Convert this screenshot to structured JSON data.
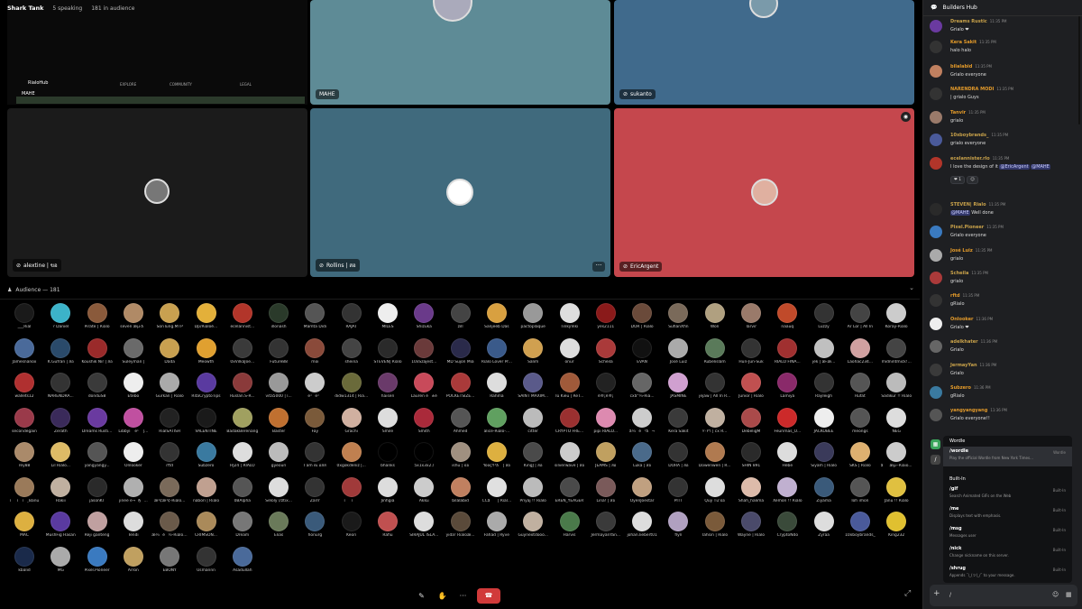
{
  "topbar": {
    "title": "Shark Tank",
    "speaking": "5 speaking",
    "audience": "181 in audience"
  },
  "tiles": [
    {
      "label": "MAHE",
      "color": "#5e8b96"
    },
    {
      "label": "sukanto",
      "color": "#406a8c"
    },
    {
      "label": "alextine | ขอ",
      "color": "#1b1b1b"
    },
    {
      "label": "Rollins | สอ",
      "color": "#406a7d"
    },
    {
      "label": "EricArgent",
      "color": "#c5474d"
    }
  ],
  "screen_share": {
    "brand": "RialoHub",
    "nav": [
      "EXPLORE",
      "COMMUNITY",
      "LEGAL"
    ],
    "name": "MAHE"
  },
  "audience_header": "Audience — 181",
  "audience": [
    {
      "n": "___Rial",
      "c": "#1a1a1a"
    },
    {
      "n": "? Daniel",
      "c": "#3cb3c9"
    },
    {
      "n": "Pirate | Rialo",
      "c": "#8a5a3b"
    },
    {
      "n": "seven æµ·å­",
      "c": "#b08a66"
    },
    {
      "n": "SonTung.MTP",
      "c": "#c8a050"
    },
    {
      "n": "Dp/Rialoè...",
      "c": "#e3b03a"
    },
    {
      "n": "ecelannist...",
      "c": "#b2352a"
    },
    {
      "n": "illonash",
      "c": "#2a3a2a"
    },
    {
      "n": "Mamta Didi",
      "c": "#555"
    },
    {
      "n": "RAJAT",
      "c": "#333"
    },
    {
      "n": "MILES",
      "c": "#eee"
    },
    {
      "n": "Shizuka",
      "c": "#6a3a8a"
    },
    {
      "n": "zill",
      "c": "#444"
    },
    {
      "n": "Sanjeeb Das",
      "c": "#d8a040"
    },
    {
      "n": "pactoplaque",
      "c": "#999"
    },
    {
      "n": "TinkyViki",
      "c": "#ddd"
    },
    {
      "n": "yes2111",
      "c": "#8a1a1a"
    },
    {
      "n": "DOR | Rialo",
      "c": "#6a4a3a"
    },
    {
      "n": "SufianXfin",
      "c": "#7a6a5a"
    },
    {
      "n": "Won",
      "c": "#b0a080"
    },
    {
      "n": "Tarvir",
      "c": "#9a7a6a"
    },
    {
      "n": "naauq",
      "c": "#c04a2a"
    },
    {
      "n": "Luzzy",
      "c": "#333"
    },
    {
      "n": "Ar Lor | All In",
      "c": "#444"
    },
    {
      "n": "Koray-Rialo",
      "c": "#ccc"
    },
    {
      "n": "Jamesnanox",
      "c": "#4a6a9a"
    },
    {
      "n": "K.Gufran | สอ",
      "c": "#2a4a6a"
    },
    {
      "n": "Koushik Nir | สอ",
      "c": "#9a2a2a"
    },
    {
      "n": "Süleyman |",
      "c": "#6a6a6a"
    },
    {
      "n": "Dada",
      "c": "#c8a050"
    },
    {
      "n": "Meowth",
      "c": "#e0a030"
    },
    {
      "n": "0xVilkaJoe...",
      "c": "#3a3a3a"
    },
    {
      "n": "Future88",
      "c": "#333"
    },
    {
      "n": "moi",
      "c": "#8a4a3a"
    },
    {
      "n": "sheina",
      "c": "#444"
    },
    {
      "n": "STEVEN| Rialo",
      "c": "#2a2a2a"
    },
    {
      "n": "10xSzajest...",
      "c": "#6a3a3a"
    },
    {
      "n": "MD Sujon Mia",
      "c": "#2a2a4a"
    },
    {
      "n": "Rialo Lover Pr...",
      "c": "#3a5a8a"
    },
    {
      "n": "Salim",
      "c": "#d0a050"
    },
    {
      "n": "onur",
      "c": "#ddd"
    },
    {
      "n": "Scheila",
      "c": "#aa3a3a"
    },
    {
      "n": "EVAN",
      "c": "#111"
    },
    {
      "n": "José Luiz",
      "c": "#aaa"
    },
    {
      "n": "Rubelislam",
      "c": "#5a7a5a"
    },
    {
      "n": "Hun-Jun-Suk",
      "c": "#333"
    },
    {
      "n": "RIALO FINA...",
      "c": "#a03030"
    },
    {
      "n": "jek | æ‹æ...",
      "c": "#c0c0c0"
    },
    {
      "n": "Laohac234...",
      "c": "#d0a0a0"
    },
    {
      "n": "midnintmick!...",
      "c": "#444"
    },
    {
      "n": "wallets12",
      "c": "#b03030"
    },
    {
      "n": "NARENDRA...",
      "c": "#333"
    },
    {
      "n": "donduS8",
      "c": "#3a3a3a"
    },
    {
      "n": "Etebo",
      "c": "#eee"
    },
    {
      "n": "Gürkan | Rialo",
      "c": "#aaa"
    },
    {
      "n": "RitaCryptoTips",
      "c": "#5a3aa0"
    },
    {
      "n": "Ruslan.S-R...",
      "c": "#8a3a3a"
    },
    {
      "n": "vita5000 | ì...",
      "c": "#999"
    },
    {
      "n": "ë¹ë¹",
      "c": "#ccc"
    },
    {
      "n": "didw1314 | Ria...",
      "c": "#6a6a3a"
    },
    {
      "n": "haisen",
      "c": "#6a3a6a"
    },
    {
      "n": "Lauren è±é",
      "c": "#c84a5a"
    },
    {
      "n": "POCKETSIZE...",
      "c": "#aa3a3a"
    },
    {
      "n": "Rahma",
      "c": "#ddd"
    },
    {
      "n": "SAINT MAXIM...",
      "c": "#5a5a8a"
    },
    {
      "n": "Tú Kiều | ReT...",
      "c": "#a05a3a"
    },
    {
      "n": "ê®¡ê®¡",
      "c": "#222"
    },
    {
      "n": "cxå°¼-Ria...",
      "c": "#666"
    },
    {
      "n": "JASMINE",
      "c": "#d0a0d0"
    },
    {
      "n": "jejaw | All In R...",
      "c": "#333"
    },
    {
      "n": "Junior | Rialo",
      "c": "#c05050"
    },
    {
      "n": "Lamiya",
      "c": "#8a2a6a"
    },
    {
      "n": "Rayleigh",
      "c": "#333"
    },
    {
      "n": "Rufat",
      "c": "#555"
    },
    {
      "n": "Sadikur !! Rialo",
      "c": "#bbb"
    },
    {
      "n": "secondegain",
      "c": "#9a3a4a"
    },
    {
      "n": "Zerath",
      "c": "#3a2a5a"
    },
    {
      "n": "Dreams Rusti...",
      "c": "#6a3aa0"
    },
    {
      "n": "Libbyì´ë¹ |...",
      "c": "#c050a0"
    },
    {
      "n": "RialSATISH",
      "c": "#222"
    },
    {
      "n": "VALENTINE",
      "c": "#1a1a1a"
    },
    {
      "n": "BadakBerenang",
      "c": "#a0a060"
    },
    {
      "n": "Baster",
      "c": "#c07030"
    },
    {
      "n": "Fay",
      "c": "#7a5a3a"
    },
    {
      "n": "Grachi",
      "c": "#d0b0a0"
    },
    {
      "n": "Smile",
      "c": "#ddd"
    },
    {
      "n": "Smith",
      "c": "#aa2a3a"
    },
    {
      "n": "Ahmed",
      "c": "#555"
    },
    {
      "n": "alice-Rialo-...",
      "c": "#60a060"
    },
    {
      "n": "citter",
      "c": "#bbb"
    },
    {
      "n": "CRYPTO FRE...",
      "c": "#9a3030"
    },
    {
      "n": "pipi RIALO...",
      "c": "#dd8ab0"
    },
    {
      "n": "å¼é³å¬",
      "c": "#ccc"
    },
    {
      "n": "Kera Sakit",
      "c": "#3a3a3a"
    },
    {
      "n": "٢٠٢٦ | cx R...",
      "c": "#c0b0a0"
    },
    {
      "n": "DebeligM",
      "c": "#aa4a4a"
    },
    {
      "n": "Feurimas_O...",
      "c": "#cc2a2a"
    },
    {
      "n": "JACKOBEE",
      "c": "#eee"
    },
    {
      "n": "meongs",
      "c": "#555"
    },
    {
      "n": "NEG",
      "c": "#ddd"
    },
    {
      "n": "rey88",
      "c": "#aa8a6a"
    },
    {
      "n": "Lil Rialo...",
      "c": "#ddbb66"
    },
    {
      "n": "yangyangy...",
      "c": "#555"
    },
    {
      "n": "Onlooker",
      "c": "#eee"
    },
    {
      "n": "rftd",
      "c": "#333"
    },
    {
      "n": "Subzero",
      "c": "#3a7aa0"
    },
    {
      "n": "HJ24 | RIALO",
      "c": "#ddd"
    },
    {
      "n": "gyeouri",
      "c": "#bbb"
    },
    {
      "n": "I am ตเ อสส",
      "c": "#333"
    },
    {
      "n": "0xgokdeniz |...",
      "c": "#c08050"
    },
    {
      "n": "bhanks",
      "c": "#000"
    },
    {
      "n": "5x1x3x2./",
      "c": "#000"
    },
    {
      "n": "ishu | ปอ",
      "c": "#a09080"
    },
    {
      "n": "YooçŸ³å­ | สอ",
      "c": "#ddb040"
    },
    {
      "n": "KingJ | สอ",
      "c": "#4a4a4a"
    },
    {
      "n": "silverwave | สอ",
      "c": "#ccc"
    },
    {
      "n": "JEAMS | สอ",
      "c": "#c0a060"
    },
    {
      "n": "Luka | สอ",
      "c": "#4a6a8a"
    },
    {
      "n": "DORA | สอ",
      "c": "#333"
    },
    {
      "n": "Dowenwen | R...",
      "c": "#b07a50"
    },
    {
      "n": "SHIN 891",
      "c": "#2a2a2a"
    },
    {
      "n": "Hebe",
      "c": "#ddd"
    },
    {
      "n": "Siyam | Rialo",
      "c": "#3a3a5a"
    },
    {
      "n": "SKS | Rialo",
      "c": "#ddb070"
    },
    {
      "n": "åæµ·-Riaio...",
      "c": "#ccc"
    },
    {
      "n": "ìì ì¸Banu",
      "c": "#9a7a5a"
    },
    {
      "n": "Hakii",
      "c": "#c0b0a0"
    },
    {
      "n": "jasonKT",
      "c": "#2a2a2a"
    },
    {
      "n": "jinee ë¬´ì§...",
      "c": "#b0b0b0"
    },
    {
      "n": "æ³¢æ³¢-Rialo...",
      "c": "#7a6a5a"
    },
    {
      "n": "nabori | Rialo",
      "c": "#c0a090"
    },
    {
      "n": "0BAlpha",
      "c": "#555"
    },
    {
      "n": "Seloly //ztix...",
      "c": "#ddd"
    },
    {
      "n": "Zarrr",
      "c": "#333"
    },
    {
      "n": "ìì",
      "c": "#a03a3a"
    },
    {
      "n": "Jinhgia",
      "c": "#ddd"
    },
    {
      "n": "Akku",
      "c": "#ccc"
    },
    {
      "n": "bilalabid",
      "c": "#c08060"
    },
    {
      "n": "CCå | Rial...",
      "c": "#e0e0e0"
    },
    {
      "n": "Priyaj !! Rialo",
      "c": "#bbb"
    },
    {
      "n": "EREN_YEAGER",
      "c": "#4a4a4a"
    },
    {
      "n": "Lina! | สอ",
      "c": "#7a5a5a"
    },
    {
      "n": "OyenJoestar",
      "c": "#c0a080"
    },
    {
      "n": "PITT",
      "c": "#333"
    },
    {
      "n": "Quy Tư ปอ",
      "c": "#ddd"
    },
    {
      "n": "Shah_halima",
      "c": "#ddbbaa"
    },
    {
      "n": "Xemon !! Rialo",
      "c": "#c0b0d0"
    },
    {
      "n": "Ziyama",
      "c": "#3a5a7a"
    },
    {
      "n": "Ioh imon",
      "c": "#555"
    },
    {
      "n": "Janu !! Rialo",
      "c": "#e0c040"
    },
    {
      "n": "MAC",
      "c": "#ddb040"
    },
    {
      "n": "MushFig Hasan",
      "c": "#5a3aa0"
    },
    {
      "n": "Reji ganteng",
      "c": "#c0a0a0"
    },
    {
      "n": "Tendi",
      "c": "#ddd"
    },
    {
      "n": "æ¼è½-Rialo-...",
      "c": "#6a5a4a"
    },
    {
      "n": "CRIMSON...",
      "c": "#aa8a5a"
    },
    {
      "n": "Dream",
      "c": "#777"
    },
    {
      "n": "Elias",
      "c": "#6a7a5a"
    },
    {
      "n": "honurg",
      "c": "#3a5a7a"
    },
    {
      "n": "Keori",
      "c": "#1a1a1a"
    },
    {
      "n": "Rafiu",
      "c": "#c05050"
    },
    {
      "n": "SIRAJUL ISLA...",
      "c": "#ddd"
    },
    {
      "n": "yida! Rialoæ...",
      "c": "#5a4a3a"
    },
    {
      "n": "Fahad | Ryve",
      "c": "#aaa"
    },
    {
      "n": "Guynextdooo...",
      "c": "#c0b0a0"
    },
    {
      "n": "Harvis",
      "c": "#4a7a4a"
    },
    {
      "n": "JermayanYan...",
      "c": "#3a3a3a"
    },
    {
      "n": "johan.liebert01",
      "c": "#ddd"
    },
    {
      "n": "flyn",
      "c": "#b0a0c0"
    },
    {
      "n": "Tahsin | Rialo",
      "c": "#7a5a3a"
    },
    {
      "n": "Wayne | Rialo",
      "c": "#4a4a6a"
    },
    {
      "n": "CryptoNdo",
      "c": "#3a4a3a"
    },
    {
      "n": "Zyraa",
      "c": "#ddd"
    },
    {
      "n": "10xboybrands_",
      "c": "#4a5a9a"
    },
    {
      "n": "King232",
      "c": "#e0c030"
    },
    {
      "n": "kbalid",
      "c": "#1a2a4a"
    },
    {
      "n": "MG",
      "c": "#aaa"
    },
    {
      "n": "Pixel.Pioneer",
      "c": "#3a7ac0"
    },
    {
      "n": "Arron",
      "c": "#c0a060"
    },
    {
      "n": "EBONY",
      "c": "#777"
    },
    {
      "n": "Usmannn",
      "c": "#333"
    },
    {
      "n": "Asadullah",
      "c": "#4a6a9a"
    }
  ],
  "controls": {
    "hangup_label": "☎",
    "more_label": "···"
  },
  "chat": {
    "title": "Builders Hub",
    "messages": [
      {
        "author": "Dreams Rustic",
        "time": "11:35 PM",
        "text": "Grialo ❤",
        "color": "#c9a24a",
        "av": "#6a3aa0"
      },
      {
        "author": "Kera Sakit",
        "time": "11:35 PM",
        "text": "halo halo",
        "color": "#e39a2a",
        "av": "#333"
      },
      {
        "author": "bilalabid",
        "time": "11:35 PM",
        "text": "Grialo everyone",
        "color": "#e39a2a",
        "av": "#c08060"
      },
      {
        "author": "NARENDRA MODI",
        "time": "11:35 PM",
        "text": "| grialo  Guys",
        "color": "#e39a2a",
        "av": "#333"
      },
      {
        "author": "Tanvir",
        "time": "11:35 PM",
        "text": "grialo",
        "color": "#e39a2a",
        "av": "#9a7a6a"
      },
      {
        "author": "10xboybrands_",
        "time": "11:35 PM",
        "text": "grialo everyone",
        "color": "#c9a24a",
        "av": "#4a5a9a"
      },
      {
        "author": "ecelannister.rlo",
        "time": "11:35 PM",
        "text": "I love the design of it ",
        "mention1": "@EricArgent",
        "mention2": "@MAHE",
        "color": "#c9a24a",
        "av": "#b2352a",
        "react1": "❤ 1",
        "react2": "☺"
      },
      {
        "author": "STEVEN| Rialo",
        "time": "11:35 PM",
        "text": " Well done",
        "mention1": "@MAHE",
        "color": "#c9a24a",
        "av": "#2a2a2a"
      },
      {
        "author": "Pixel.Pioneer",
        "time": "11:35 PM",
        "text": "Grialo everyone",
        "color": "#c9a24a",
        "av": "#3a7ac0"
      },
      {
        "author": "José Luiz",
        "time": "11:35 PM",
        "text": "grialo",
        "color": "#e39a2a",
        "av": "#aaa"
      },
      {
        "author": "Scheila",
        "time": "11:35 PM",
        "text": "grialo",
        "color": "#c9a24a",
        "av": "#aa3a3a"
      },
      {
        "author": "rftd",
        "time": "11:35 PM",
        "text": "gRialo",
        "color": "#e39a2a",
        "av": "#333"
      },
      {
        "author": "Onlooker",
        "time": "11:36 PM",
        "text": "Grialo ❤",
        "color": "#e39a2a",
        "av": "#eee"
      },
      {
        "author": "adelkhater",
        "time": "11:36 PM",
        "text": "Grialo",
        "color": "#c9a24a",
        "av": "#666"
      },
      {
        "author": "JermayYan",
        "time": "11:36 PM",
        "text": "Grialo",
        "color": "#c9a24a",
        "av": "#3a3a3a"
      },
      {
        "author": "Subzero",
        "time": "11:36 PM",
        "text": "gRialo",
        "color": "#e39a2a",
        "av": "#3a7aa0"
      },
      {
        "author": "yangyangyang",
        "time": "11:36 PM",
        "text": "Grialo everyone!!",
        "color": "#e39a2a",
        "av": "#555"
      }
    ],
    "popup": {
      "group1": "Wordle",
      "cmd1": "/wordle",
      "desc1": "Play the official Wordle from New York Times...",
      "src1": "Wordle",
      "group2": "Built-In",
      "cmds": [
        {
          "c": "/gif",
          "d": "Search Animated GIFs on the Web",
          "s": "Built-In"
        },
        {
          "c": "/me",
          "d": "Displays text with emphasis.",
          "s": "Built-In"
        },
        {
          "c": "/msg",
          "d": "Messages user",
          "s": "Built-In"
        },
        {
          "c": "/nick",
          "d": "Change nickname on this server.",
          "s": "Built-In"
        },
        {
          "c": "/shrug",
          "d": "Appends ¯\\_(ツ)_/¯ to your message.",
          "s": "Built-In"
        }
      ]
    },
    "composer_value": "/"
  }
}
